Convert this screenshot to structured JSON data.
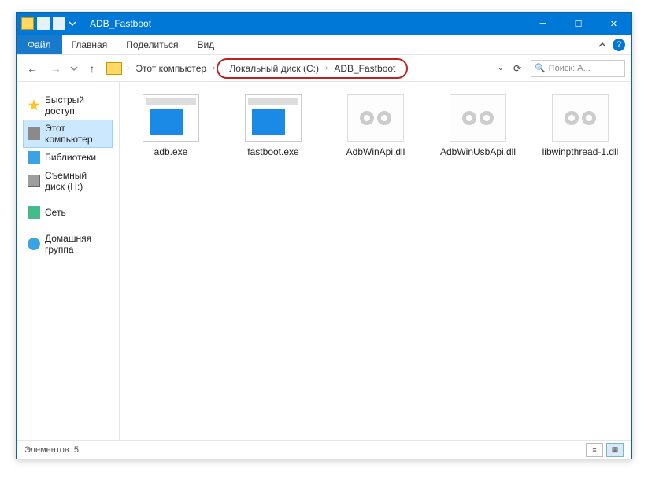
{
  "title": "ADB_Fastboot",
  "file_menu": "Файл",
  "tabs": {
    "home": "Главная",
    "share": "Поделиться",
    "view": "Вид"
  },
  "breadcrumb": {
    "root": "Этот компьютер",
    "parts": [
      "Локальный диск (C:)",
      "ADB_Fastboot"
    ]
  },
  "search_placeholder": "Поиск: A...",
  "sidebar": {
    "quick": "Быстрый доступ",
    "thispc": "Этот компьютер",
    "libs": "Библиотеки",
    "removable": "Съемный диск (H:)",
    "network": "Сеть",
    "homegroup": "Домашняя группа"
  },
  "files": [
    {
      "name": "adb.exe",
      "type": "exe"
    },
    {
      "name": "fastboot.exe",
      "type": "exe"
    },
    {
      "name": "AdbWinApi.dll",
      "type": "dll"
    },
    {
      "name": "AdbWinUsbApi.dll",
      "type": "dll"
    },
    {
      "name": "libwinpthread-1.dll",
      "type": "dll"
    }
  ],
  "status": "Элементов: 5"
}
